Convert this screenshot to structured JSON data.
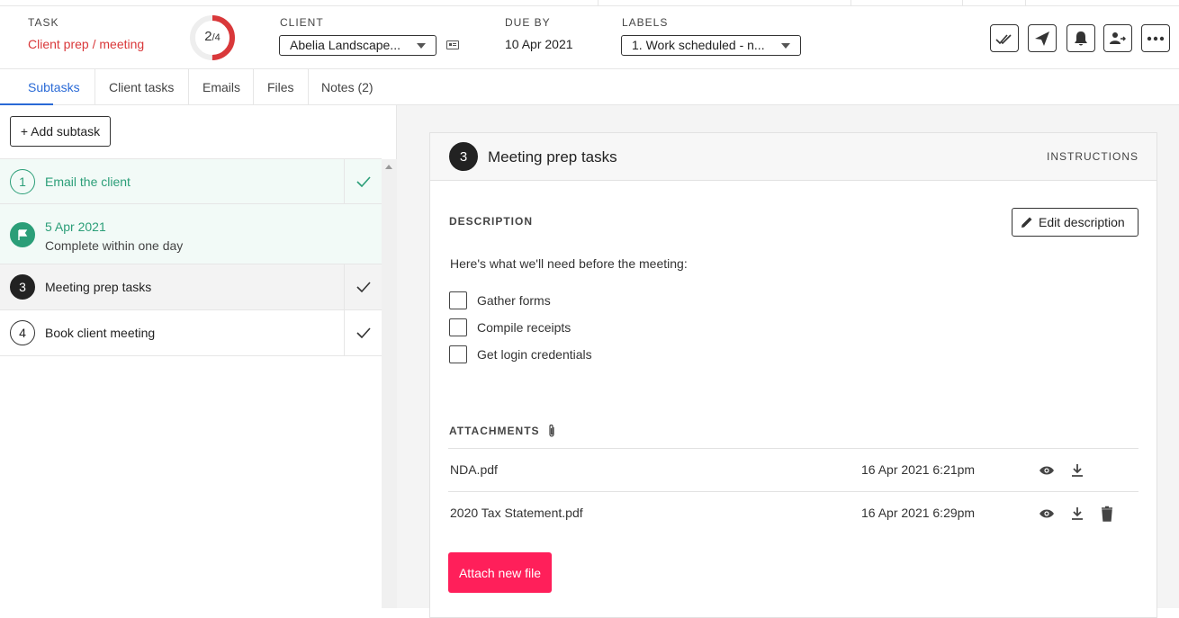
{
  "header": {
    "task_label": "TASK",
    "task_name": "Client prep / meeting",
    "progress_done": "2",
    "progress_total": "/4",
    "progress_fraction": 0.5,
    "client_label": "CLIENT",
    "client_value": "Abelia Landscape...",
    "due_label": "DUE BY",
    "due_value": "10 Apr 2021",
    "labels_label": "LABELS",
    "labels_value": "1. Work scheduled - n..."
  },
  "toolbar": {
    "icons": [
      "double-check-icon",
      "send-icon",
      "bell-icon",
      "assign-user-icon",
      "more-icon"
    ]
  },
  "tabs": [
    {
      "label": "Subtasks",
      "active": true
    },
    {
      "label": "Client tasks"
    },
    {
      "label": "Emails"
    },
    {
      "label": "Files"
    },
    {
      "label": "Notes (2)"
    }
  ],
  "subtasks": {
    "add_label": "+ Add subtask",
    "items": [
      {
        "number": "1",
        "label": "Email the client",
        "state": "done"
      },
      {
        "date": "5 Apr 2021",
        "note": "Complete within one day",
        "state": "milestone"
      },
      {
        "number": "3",
        "label": "Meeting prep tasks",
        "state": "selected"
      },
      {
        "number": "4",
        "label": "Book client meeting",
        "state": "pending"
      }
    ]
  },
  "detail": {
    "number": "3",
    "title": "Meeting prep tasks",
    "instructions": "INSTRUCTIONS",
    "description_heading": "DESCRIPTION",
    "edit_label": "Edit description",
    "description_text": "Here's what we'll need before the meeting:",
    "checklist": [
      "Gather forms",
      "Compile receipts",
      "Get login credentials"
    ],
    "attachments_heading": "ATTACHMENTS",
    "attachments": [
      {
        "name": "NDA.pdf",
        "date": "16 Apr 2021 6:21pm"
      },
      {
        "name": "2020 Tax Statement.pdf",
        "date": "16 Apr 2021 6:29pm"
      }
    ],
    "attach_label": "Attach new file"
  },
  "colors": {
    "accent_red": "#d9383a",
    "tab_blue": "#2a6ad6",
    "done_green": "#2b9e78",
    "attach_pink": "#ff1f5a"
  }
}
